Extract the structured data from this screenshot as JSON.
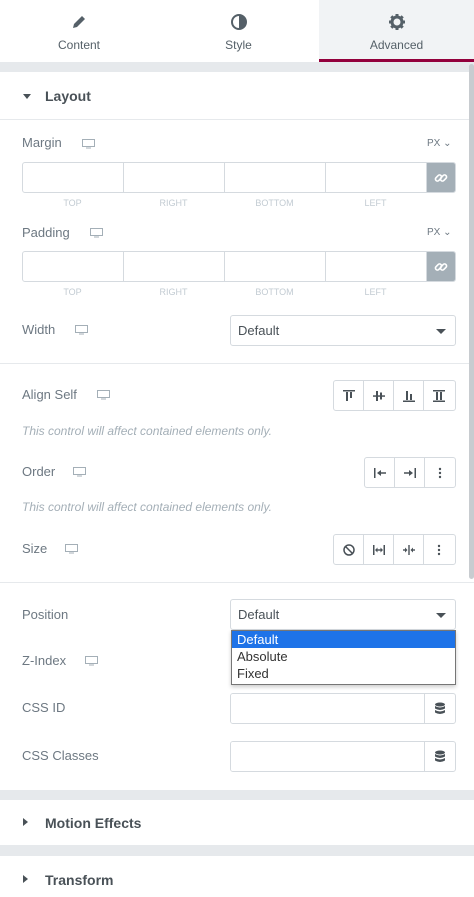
{
  "tabs": [
    {
      "label": "Content",
      "icon": "pencil-icon",
      "active": false
    },
    {
      "label": "Style",
      "icon": "contrast-icon",
      "active": false
    },
    {
      "label": "Advanced",
      "icon": "gear-icon",
      "active": true
    }
  ],
  "colors": {
    "accent": "#93003c",
    "selected_option": "#1e73e8",
    "link_button": "#a4afb7"
  },
  "layout": {
    "title": "Layout",
    "margin": {
      "label": "Margin",
      "unit": "PX",
      "sides": [
        "TOP",
        "RIGHT",
        "BOTTOM",
        "LEFT"
      ]
    },
    "padding": {
      "label": "Padding",
      "unit": "PX",
      "sides": [
        "TOP",
        "RIGHT",
        "BOTTOM",
        "LEFT"
      ]
    },
    "width": {
      "label": "Width",
      "value": "Default"
    },
    "align_self": {
      "label": "Align Self",
      "note": "This control will affect contained elements only."
    },
    "order": {
      "label": "Order",
      "note": "This control will affect contained elements only."
    },
    "size": {
      "label": "Size"
    },
    "position": {
      "label": "Position",
      "value": "Default",
      "options": [
        "Default",
        "Absolute",
        "Fixed"
      ]
    },
    "z_index": {
      "label": "Z-Index"
    },
    "css_id": {
      "label": "CSS ID",
      "value": ""
    },
    "css_classes": {
      "label": "CSS Classes",
      "value": ""
    }
  },
  "sections": {
    "motion_effects": "Motion Effects",
    "transform": "Transform"
  }
}
